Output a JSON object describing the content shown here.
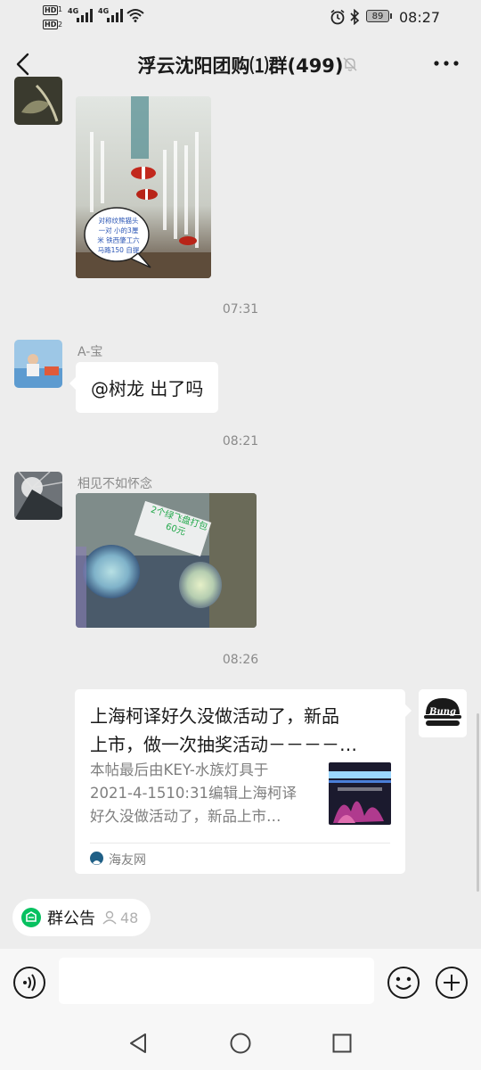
{
  "status_bar": {
    "hd_tags": [
      "HD",
      "HD"
    ],
    "sim_labels": [
      "1",
      "2"
    ],
    "net_labels": [
      "4G",
      "4G"
    ],
    "battery": "89",
    "time": "08:27"
  },
  "header": {
    "title": "浮云沈阳团购⑴群(499)",
    "muted_icon": "bell-off-icon",
    "more_icon": "more-icon",
    "back_icon": "back-arrow-icon"
  },
  "messages": {
    "photo1_caption": "对称纹熊猫头\n一对  小的3厘\n米  铁西肇工六\n马路150  自提",
    "time1": "07:31",
    "msg2": {
      "sender": "A-宝",
      "text": "@树龙  出了吗"
    },
    "time2": "08:21",
    "msg3": {
      "sender": "相见不如怀念",
      "photo_caption": "2个绿飞盘打包\n60元"
    },
    "time3": "08:26",
    "link_card": {
      "title": "上海柯译好久没做活动了，新品\n上市，做一次抽奖活动－－－－…",
      "description": "本帖最后由KEY-水族灯具于\n2021-4-1510:31编辑上海柯译\n好久没做活动了，新品上市…",
      "source": "海友网",
      "avatar_text": "Bung"
    }
  },
  "group_notice": {
    "label": "群公告",
    "count": "48"
  },
  "input_bar": {
    "voice_icon": "voice-icon",
    "emoji_icon": "emoji-icon",
    "add_icon": "plus-icon"
  },
  "nav_bar": {
    "back": "nav-back-icon",
    "home": "nav-home-icon",
    "recent": "nav-recent-icon"
  },
  "colors": {
    "background": "#ededed",
    "green": "#07c160",
    "bubble": "#ffffff"
  }
}
